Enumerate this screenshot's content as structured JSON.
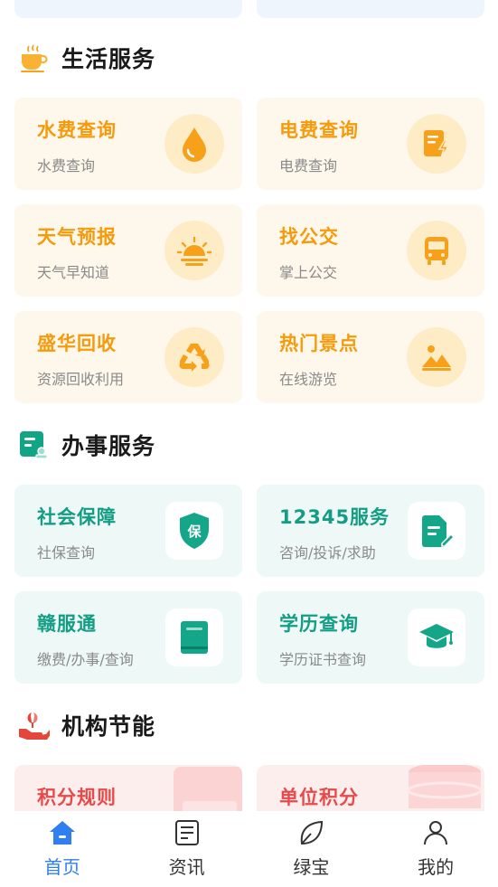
{
  "sections": {
    "life": {
      "title": "生活服务",
      "icon": "coffee-cup-icon"
    },
    "affairs": {
      "title": "办事服务",
      "icon": "document-stamp-icon"
    },
    "energy": {
      "title": "机构节能",
      "icon": "hand-sprout-icon"
    }
  },
  "life_cards": [
    {
      "title": "水费查询",
      "subtitle": "水费查询",
      "icon": "water-drop-icon"
    },
    {
      "title": "电费查询",
      "subtitle": "电费查询",
      "icon": "electric-bill-icon"
    },
    {
      "title": "天气预报",
      "subtitle": "天气早知道",
      "icon": "sunrise-icon"
    },
    {
      "title": "找公交",
      "subtitle": "掌上公交",
      "icon": "bus-icon"
    },
    {
      "title": "盛华回收",
      "subtitle": "资源回收利用",
      "icon": "recycle-icon"
    },
    {
      "title": "热门景点",
      "subtitle": "在线游览",
      "icon": "mountain-picture-icon"
    }
  ],
  "affairs_cards": [
    {
      "title": "社会保障",
      "subtitle": "社保查询",
      "icon": "shield-icon",
      "badge_text": "保"
    },
    {
      "title": "12345服务",
      "subtitle": "咨询/投诉/求助",
      "icon": "document-edit-icon"
    },
    {
      "title": "赣服通",
      "subtitle": "缴费/办事/查询",
      "icon": "book-icon"
    },
    {
      "title": "学历查询",
      "subtitle": "学历证书查询",
      "icon": "graduation-cap-icon"
    }
  ],
  "energy_cards": [
    {
      "title": "积分规则"
    },
    {
      "title": "单位积分"
    }
  ],
  "tabbar": [
    {
      "label": "首页",
      "icon": "home-icon",
      "active": true
    },
    {
      "label": "资讯",
      "icon": "news-icon",
      "active": false
    },
    {
      "label": "绿宝",
      "icon": "leaf-icon",
      "active": false
    },
    {
      "label": "我的",
      "icon": "user-icon",
      "active": false
    }
  ],
  "colors": {
    "orange_accent": "#f69a0b",
    "green_accent": "#139d84",
    "pink_accent": "#e84a4a",
    "tab_active": "#2f7ff0"
  }
}
